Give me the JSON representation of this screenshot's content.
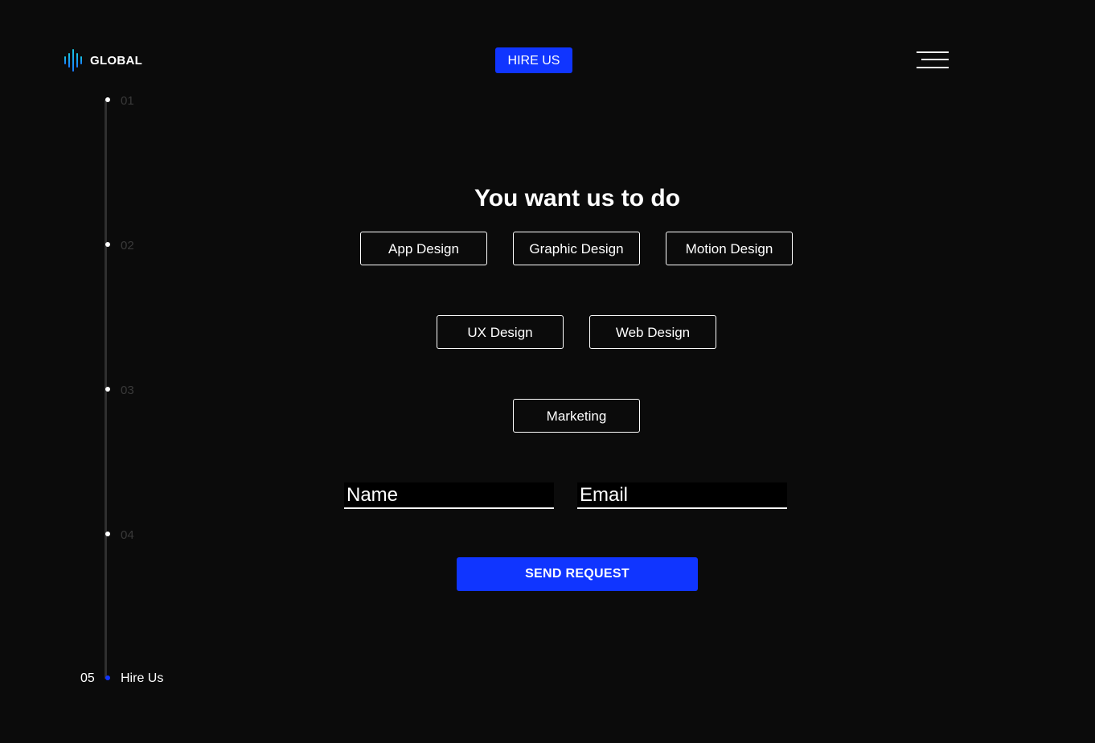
{
  "header": {
    "logo_text": "GLOBAL",
    "logo_icon": "sound-wave-icon",
    "hire_label": "HIRE US",
    "menu_icon": "hamburger-menu-icon"
  },
  "timeline": {
    "steps": [
      "01",
      "02",
      "03",
      "04",
      "05"
    ],
    "active_number": "05",
    "active_label": "Hire Us"
  },
  "main": {
    "heading": "You want us to do",
    "services": [
      "App Design",
      "Graphic Design",
      "Motion Design",
      "UX Design",
      "Web Design",
      "Marketing"
    ],
    "name_placeholder": "Name",
    "email_placeholder": "Email",
    "submit_label": "SEND REQUEST"
  },
  "colors": {
    "background": "#0b0b0b",
    "accent": "#1035ff",
    "logo_gradient_start": "#19c6e0",
    "logo_gradient_end": "#1a7cff"
  }
}
